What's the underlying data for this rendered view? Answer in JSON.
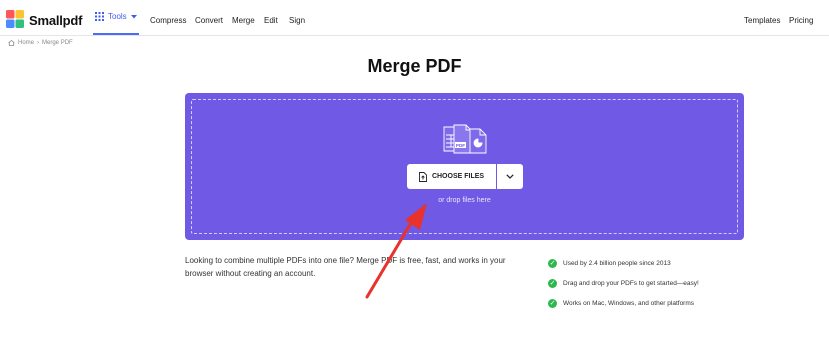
{
  "app": {
    "brand": "Smallpdf",
    "colors": {
      "accent": "#7059e5",
      "tools_blue": "#3d5cf5",
      "check_green": "#2db84c",
      "annotation_red": "#e8322b"
    }
  },
  "nav": {
    "tools_label": "Tools",
    "links": [
      "Compress",
      "Convert",
      "Merge",
      "Edit",
      "Sign"
    ],
    "right_links": [
      "Templates",
      "Pricing"
    ]
  },
  "breadcrumb": {
    "home": "Home",
    "separator": "›",
    "current": "Merge PDF"
  },
  "page": {
    "title": "Merge PDF"
  },
  "dropzone": {
    "choose_label": "CHOOSE FILES",
    "drop_hint": "or drop files here",
    "illustration_badge": "PDF"
  },
  "description": "Looking to combine multiple PDFs into one file? Merge PDF is free, fast, and works in your browser without creating an account.",
  "features": [
    "Used by 2.4 billion people since 2013",
    "Drag and drop your PDFs to get started—easy!",
    "Works on Mac, Windows, and other platforms"
  ]
}
